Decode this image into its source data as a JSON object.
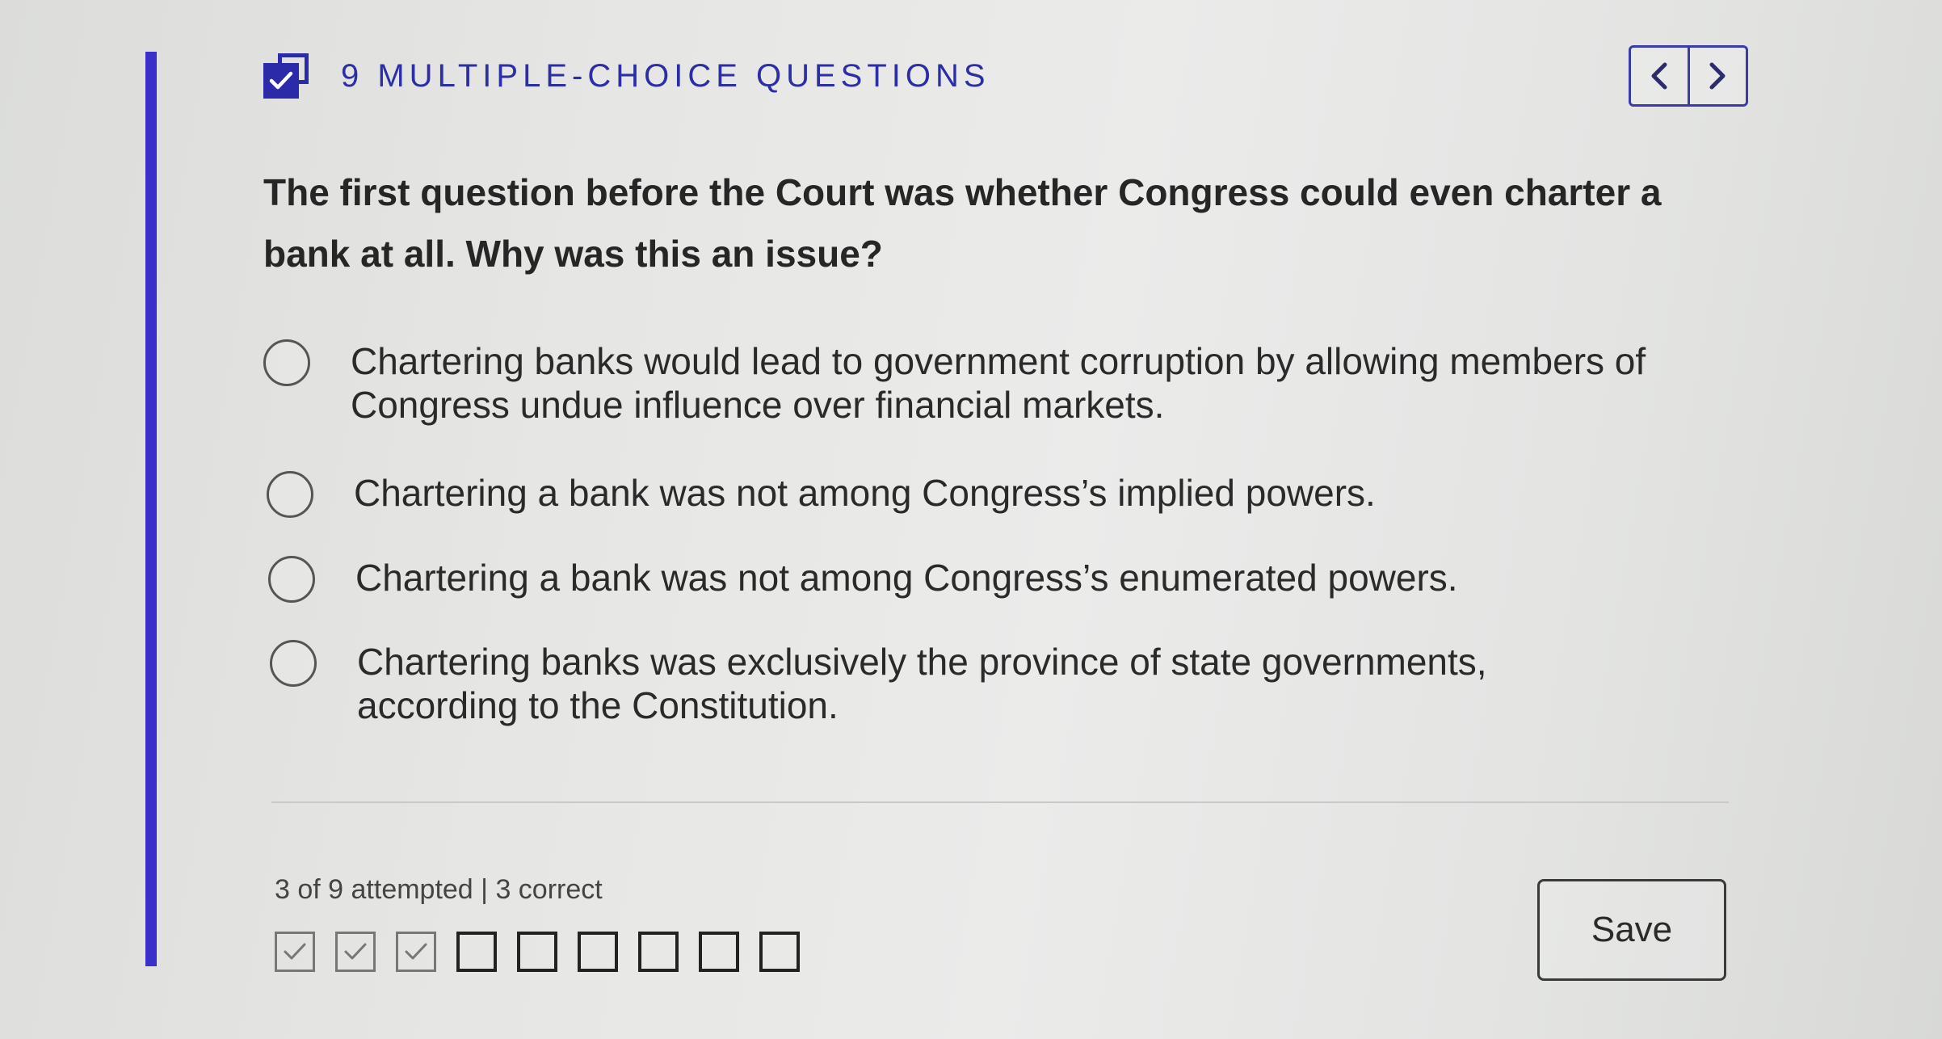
{
  "header": {
    "title": "9 MULTIPLE-CHOICE QUESTIONS",
    "icon": "checked-stack-icon",
    "accent_color": "#2b2aa8"
  },
  "nav": {
    "prev_icon": "chevron-left-icon",
    "next_icon": "chevron-right-icon"
  },
  "question": {
    "text": "The first question before the Court was whether Congress could even charter a bank at all. Why was this an issue?"
  },
  "options": [
    {
      "text": "Chartering banks would lead to government corruption by allowing members of Congress undue influence over financial markets.",
      "selected": false
    },
    {
      "text": "Chartering a bank was not among Congress’s implied powers.",
      "selected": false
    },
    {
      "text": "Chartering a bank was not among Congress’s enumerated powers.",
      "selected": false
    },
    {
      "text": "Chartering banks was exclusively the province of state governments, according to the Constitution.",
      "selected": false
    }
  ],
  "footer": {
    "status": "3 of 9 attempted | 3 correct",
    "progress": [
      true,
      true,
      true,
      false,
      false,
      false,
      false,
      false,
      false
    ],
    "save_label": "Save"
  }
}
